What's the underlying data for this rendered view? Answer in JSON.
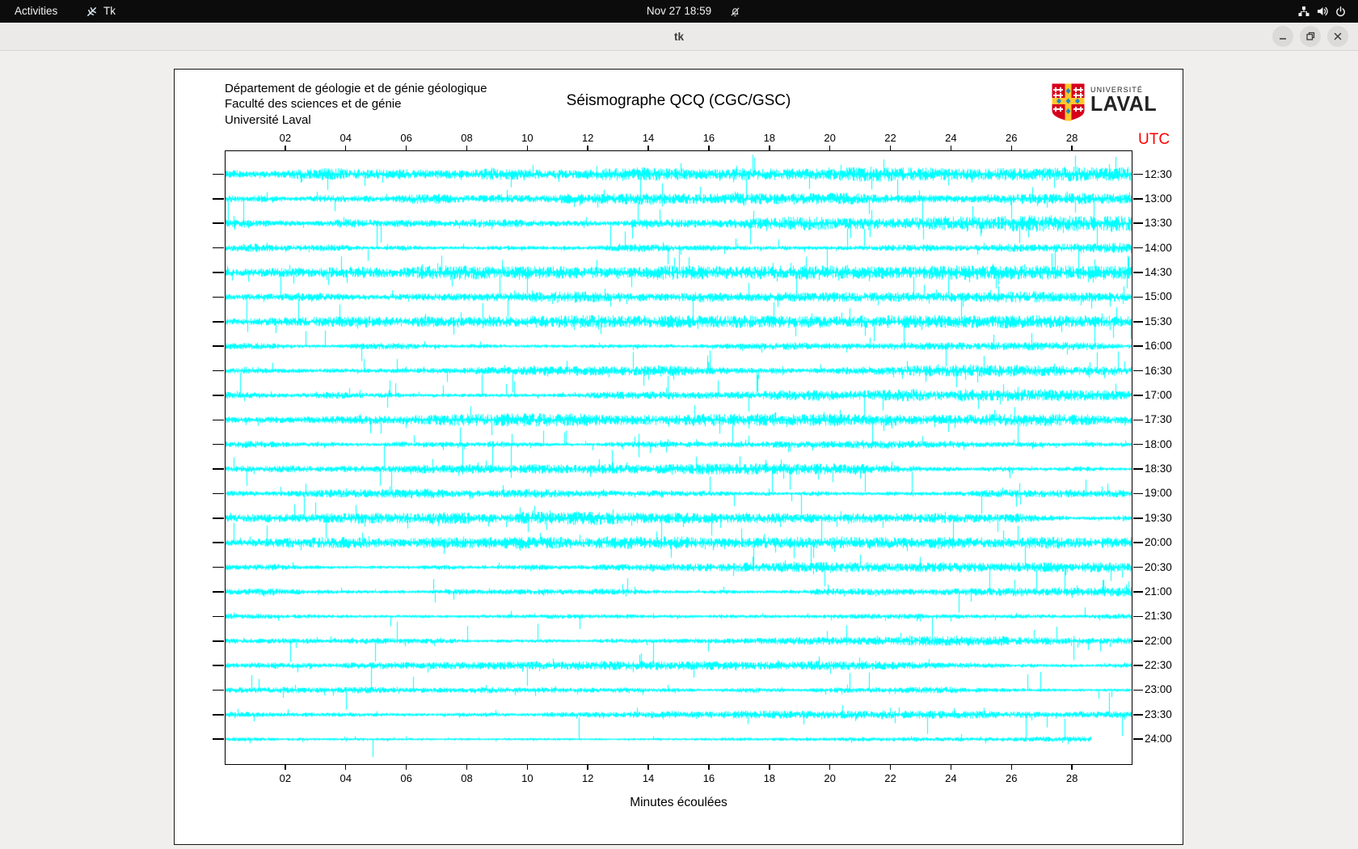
{
  "topbar": {
    "activities": "Activities",
    "app_name": "Tk",
    "clock": "Nov 27 18:59",
    "icons": [
      "tk-icon",
      "notifications-disabled-icon",
      "network-icon",
      "volume-icon",
      "power-icon"
    ]
  },
  "window": {
    "title": "tk",
    "controls": [
      "minimize",
      "restore",
      "close"
    ]
  },
  "seismograph": {
    "header_lines": [
      "Département de géologie et de génie géologique",
      "Faculté des sciences et de génie",
      "Université Laval"
    ],
    "title": "Séismographe QCQ (CGC/GSC)",
    "utc_label": "UTC",
    "utc_color": "#ff0000",
    "xlabel": "Minutes écoulées",
    "x_ticks": [
      "02",
      "04",
      "06",
      "08",
      "10",
      "12",
      "14",
      "16",
      "18",
      "20",
      "22",
      "24",
      "26",
      "28"
    ],
    "x_minutes_span": 30,
    "row_times": [
      "12:30",
      "13:00",
      "13:30",
      "14:00",
      "14:30",
      "15:00",
      "15:30",
      "16:00",
      "16:30",
      "17:00",
      "17:30",
      "18:00",
      "18:30",
      "19:00",
      "19:30",
      "20:00",
      "20:30",
      "21:00",
      "21:30",
      "22:00",
      "22:30",
      "23:00",
      "23:30",
      "24:00"
    ],
    "trace_color": "#00ffff",
    "last_row_end_fraction": 0.955,
    "logo": {
      "line1": "UNIVERSITÉ",
      "line2": "LAVAL",
      "shield_red": "#d6001c",
      "shield_gold": "#ffc72c",
      "shield_blue": "#1e8bc3"
    }
  }
}
